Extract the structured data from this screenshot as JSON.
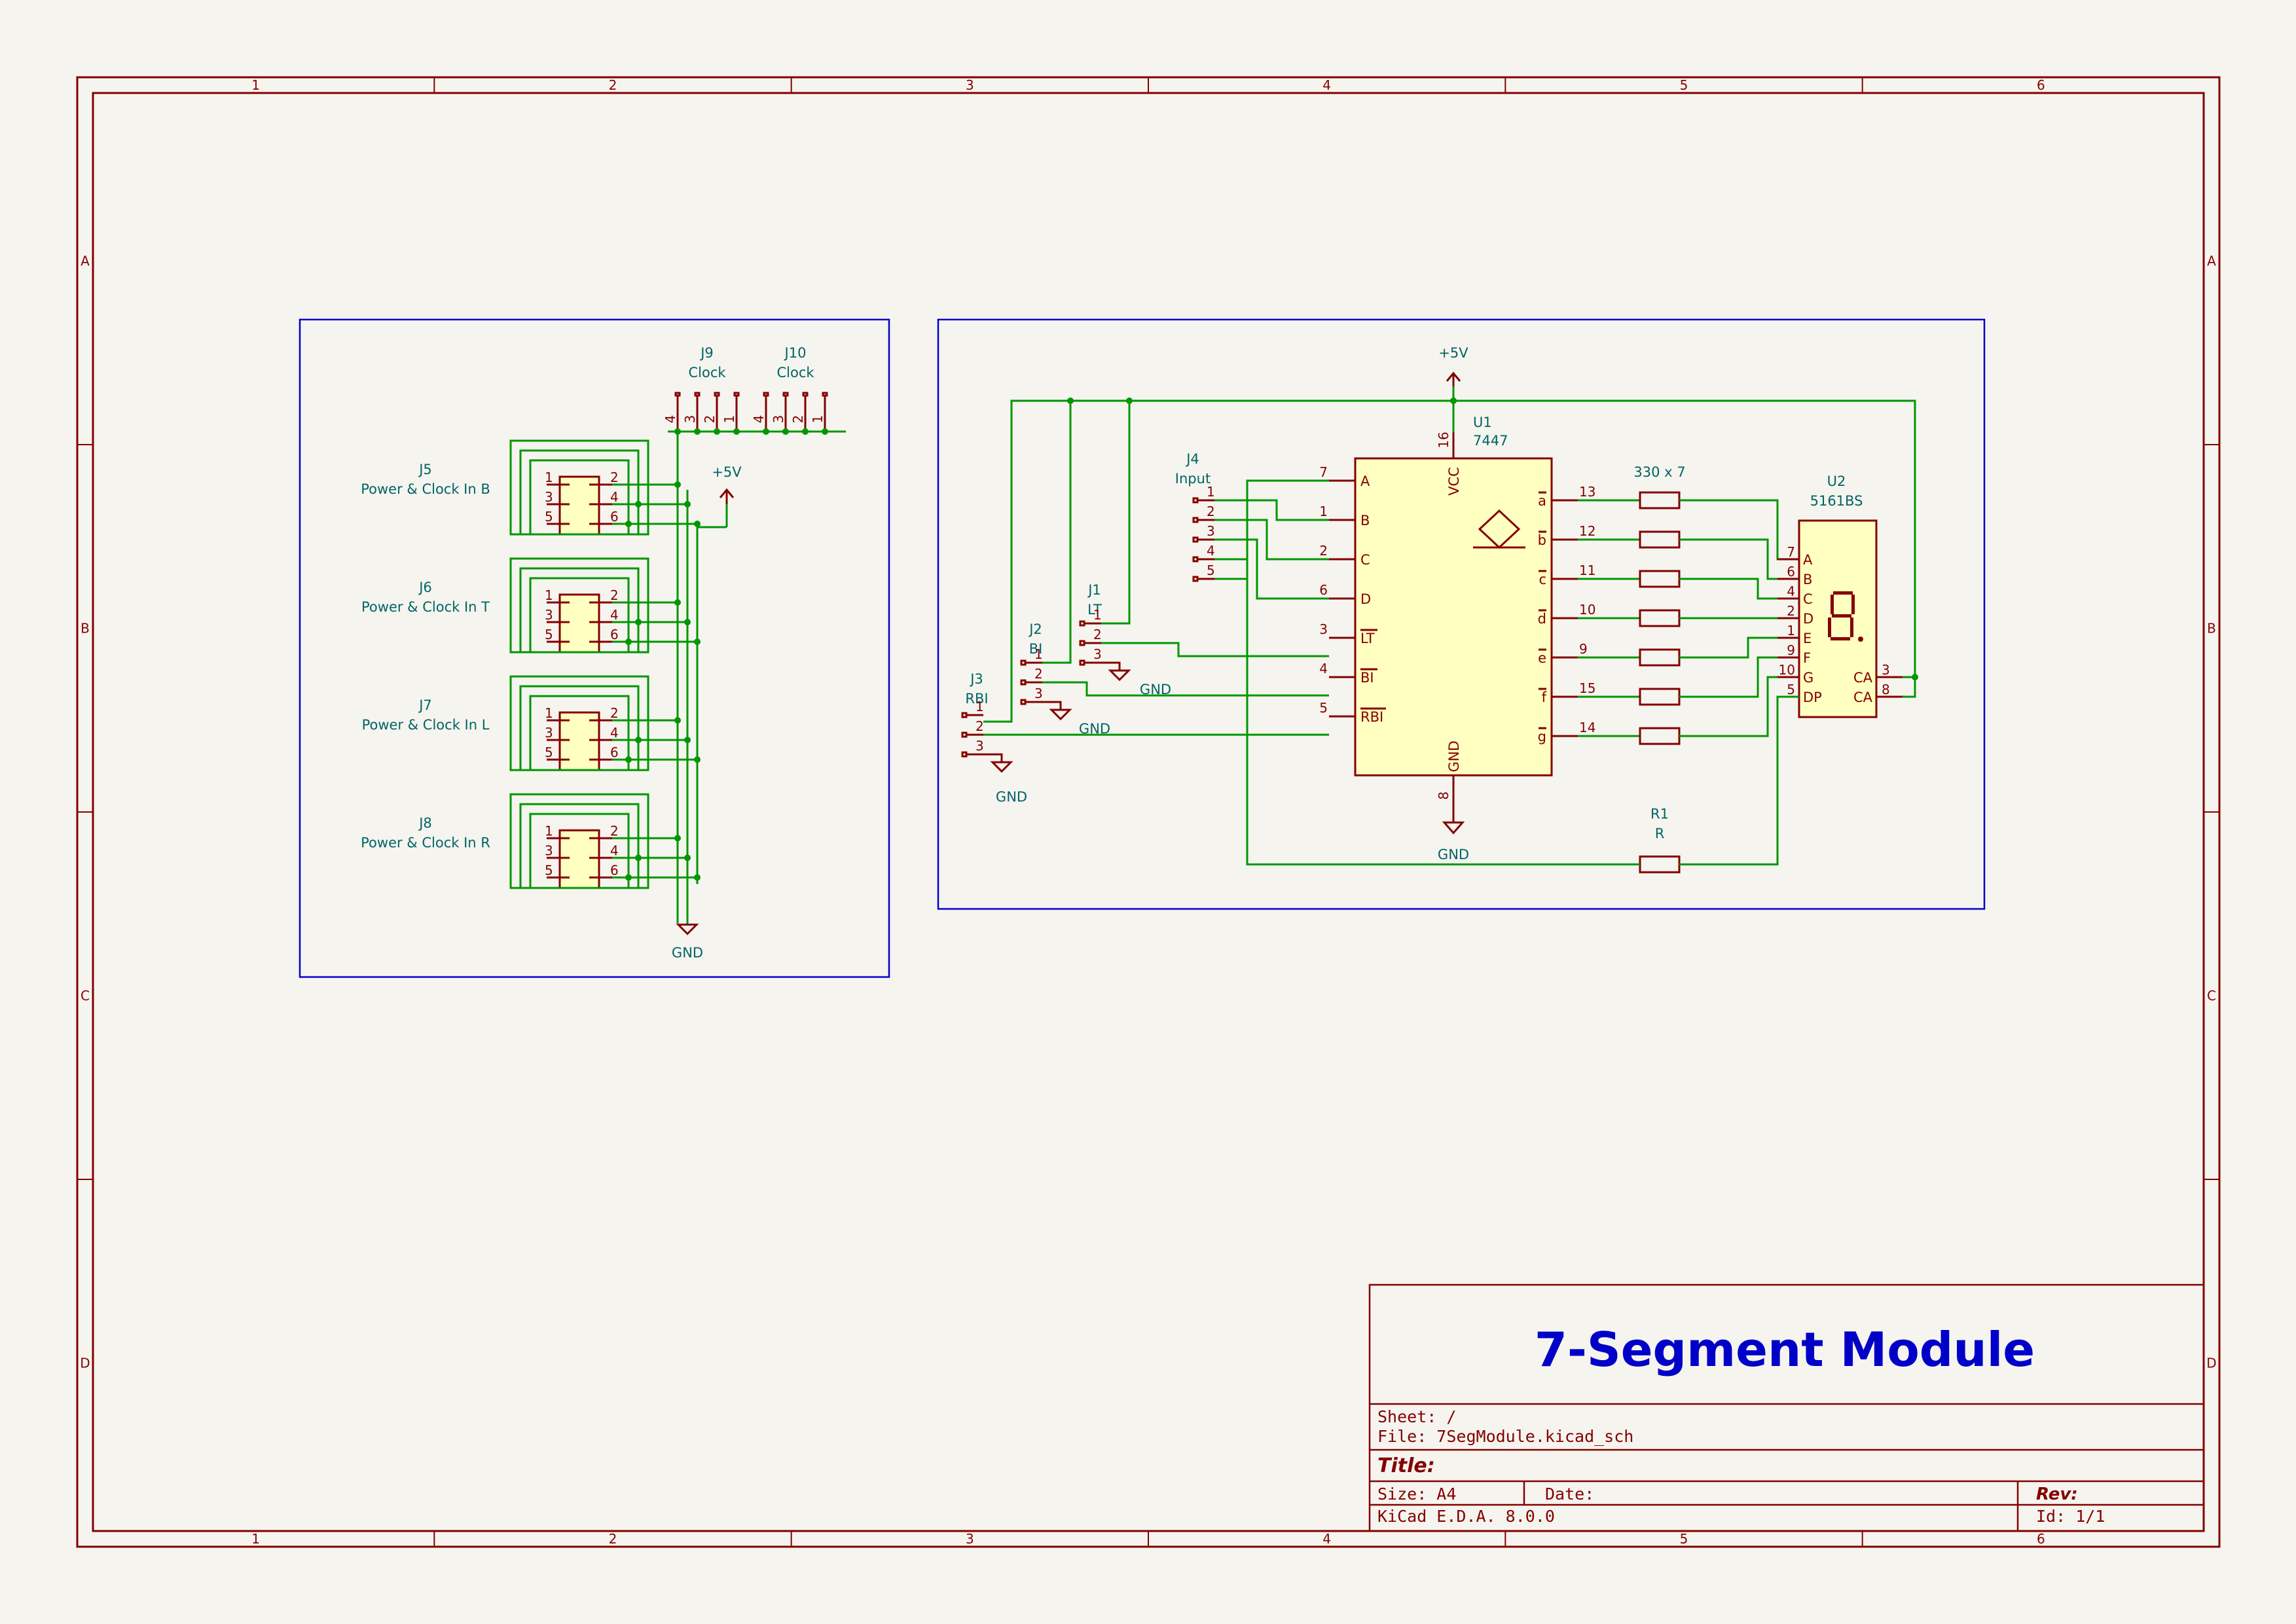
{
  "frame": {
    "columns": [
      "1",
      "2",
      "3",
      "4",
      "5",
      "6"
    ],
    "rows": [
      "A",
      "B",
      "C",
      "D"
    ]
  },
  "power_block": {
    "connectors": [
      {
        "ref": "J5",
        "value": "Power & Clock In B",
        "pins": [
          "1",
          "2",
          "3",
          "4",
          "5",
          "6"
        ]
      },
      {
        "ref": "J6",
        "value": "Power & Clock In T",
        "pins": [
          "1",
          "2",
          "3",
          "4",
          "5",
          "6"
        ]
      },
      {
        "ref": "J7",
        "value": "Power & Clock In L",
        "pins": [
          "1",
          "2",
          "3",
          "4",
          "5",
          "6"
        ]
      },
      {
        "ref": "J8",
        "value": "Power & Clock In R",
        "pins": [
          "1",
          "2",
          "3",
          "4",
          "5",
          "6"
        ]
      }
    ],
    "clock_headers": [
      {
        "ref": "J9",
        "value": "Clock",
        "pins": [
          "4",
          "3",
          "2",
          "1"
        ]
      },
      {
        "ref": "J10",
        "value": "Clock",
        "pins": [
          "4",
          "3",
          "2",
          "1"
        ]
      }
    ],
    "vcc_label": "+5V",
    "gnd_label": "GND"
  },
  "logic_block": {
    "vcc_label": "+5V",
    "gnd_labels": [
      "GND",
      "GND",
      "GND",
      "GND"
    ],
    "u1": {
      "ref": "U1",
      "value": "7447",
      "left_pins": [
        {
          "num": "7",
          "name": "A"
        },
        {
          "num": "1",
          "name": "B"
        },
        {
          "num": "2",
          "name": "C"
        },
        {
          "num": "6",
          "name": "D"
        },
        {
          "num": "3",
          "name": "LT"
        },
        {
          "num": "4",
          "name": "BI"
        },
        {
          "num": "5",
          "name": "RBI"
        }
      ],
      "right_pins": [
        {
          "num": "13",
          "name": "a"
        },
        {
          "num": "12",
          "name": "b"
        },
        {
          "num": "11",
          "name": "c"
        },
        {
          "num": "10",
          "name": "d"
        },
        {
          "num": "9",
          "name": "e"
        },
        {
          "num": "15",
          "name": "f"
        },
        {
          "num": "14",
          "name": "g"
        }
      ],
      "vcc_pin": {
        "num": "16",
        "name": "VCC"
      },
      "gnd_pin": {
        "num": "8",
        "name": "GND"
      }
    },
    "u2": {
      "ref": "U2",
      "value": "5161BS",
      "left_pins": [
        {
          "num": "7",
          "name": "A"
        },
        {
          "num": "6",
          "name": "B"
        },
        {
          "num": "4",
          "name": "C"
        },
        {
          "num": "2",
          "name": "D"
        },
        {
          "num": "1",
          "name": "E"
        },
        {
          "num": "9",
          "name": "F"
        },
        {
          "num": "10",
          "name": "G"
        },
        {
          "num": "5",
          "name": "DP"
        }
      ],
      "right_pins": [
        {
          "num": "3",
          "name": "CA"
        },
        {
          "num": "8",
          "name": "CA"
        }
      ],
      "segment_marks": [
        "a",
        "b",
        "c",
        "d",
        "e",
        "f",
        "g",
        "DP"
      ]
    },
    "resistor_array": {
      "value": "330 x 7"
    },
    "r1": {
      "ref": "R1",
      "value": "R"
    },
    "j4": {
      "ref": "J4",
      "value": "Input",
      "pins": [
        "1",
        "2",
        "3",
        "4",
        "5"
      ]
    },
    "j1": {
      "ref": "J1",
      "value": "LT",
      "pins": [
        "1",
        "2",
        "3"
      ]
    },
    "j2": {
      "ref": "J2",
      "value": "BI",
      "pins": [
        "1",
        "2",
        "3"
      ]
    },
    "j3": {
      "ref": "J3",
      "value": "RBI",
      "pins": [
        "1",
        "2",
        "3"
      ]
    }
  },
  "title_block": {
    "title": "7-Segment Module",
    "sheet": "Sheet: /",
    "file": "File: 7SegModule.kicad_sch",
    "title_label": "Title:",
    "size": "Size: A4",
    "date": "Date:",
    "rev": "Rev:",
    "tool": "KiCad E.D.A. 8.0.0",
    "id": "Id: 1/1"
  },
  "colors": {
    "frame": "#840000",
    "wire": "#009600",
    "label": "#006464",
    "symbol_fill": "#ffffc2",
    "group_box": "#0000c8",
    "background": "#f5f4ef"
  }
}
